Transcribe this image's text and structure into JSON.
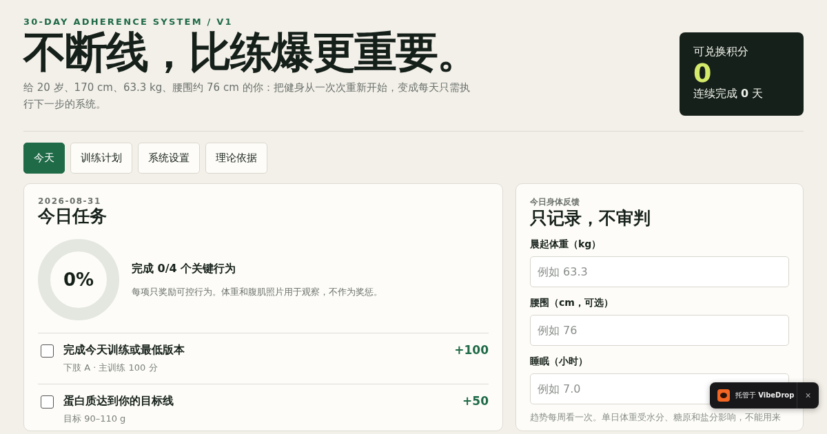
{
  "header": {
    "eyebrow": "30-DAY ADHERENCE SYSTEM / V1",
    "title": "不断线，比练爆更重要。",
    "subtitle": "给 20 岁、170 cm、63.3 kg、腰围约 76 cm 的你：把健身从一次次重新开始，变成每天只需执行下一步的系统。"
  },
  "points_card": {
    "label": "可兑换积分",
    "value": "0",
    "streak": "连续完成 **0** 天"
  },
  "tabs": [
    {
      "label": "今天",
      "selected": true
    },
    {
      "label": "训练计划",
      "selected": false
    },
    {
      "label": "系统设置",
      "selected": false
    },
    {
      "label": "理论依据",
      "selected": false
    }
  ],
  "tasks_panel": {
    "date": "2026-08-31",
    "title": "今日任务",
    "progress": {
      "level": 0,
      "percent": "0%",
      "summary": "完成 **0/4** 个关键行为",
      "note": "每项只奖励可控行为。体重和腹肌照片用于观察，不作为奖惩。"
    },
    "tasks": [
      {
        "title": "完成今天训练或最低版本",
        "detail": "下肢 A · 主训练 100 分",
        "points": "+100",
        "checked": false
      },
      {
        "title": "蛋白质达到你的目标线",
        "detail": "目标 90–110 g",
        "points": "+50",
        "checked": false
      }
    ]
  },
  "feedback_panel": {
    "eyebrow": "今日身体反馈",
    "title": "只记录，不审判",
    "fields": [
      {
        "label": "晨起体重（kg）",
        "placeholder": "例如 63.3"
      },
      {
        "label": "腰围（cm，可选）",
        "placeholder": "例如 76"
      },
      {
        "label": "睡眠（小时）",
        "placeholder": "例如 7.0"
      }
    ],
    "note": "趋势每周看一次。单日体重受水分、糖原和盐分影响，不能用来"
  },
  "host_badge": {
    "text": "托管于 **VibeDrop**",
    "close": "×"
  }
}
